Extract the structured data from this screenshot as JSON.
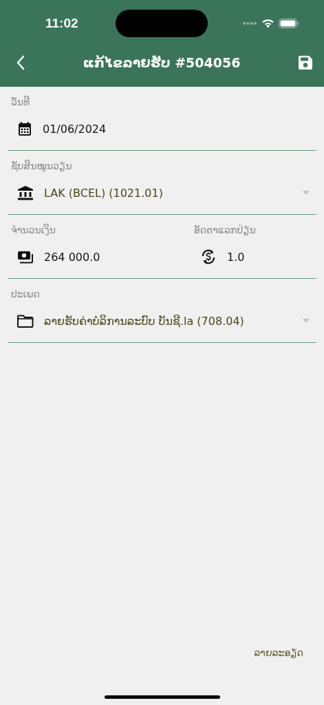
{
  "status_bar": {
    "time": "11:02"
  },
  "header": {
    "title": "ແກ້ໄຂລາຍຮັບ #504056"
  },
  "form_rows": [
    {
      "fields": [
        {
          "kind": "date",
          "label": "ວັນທີ",
          "value": "01/06/2024"
        }
      ]
    },
    {
      "fields": [
        {
          "kind": "account",
          "label": "ຊັບສິນໝູນວຽນ",
          "value": "LAK (BCEL) (1021.01)"
        }
      ]
    },
    {
      "fields": [
        {
          "kind": "amount",
          "label": "ຈຳນວນເງິນ",
          "value": "264 000.0"
        },
        {
          "kind": "rate",
          "label": "ອັດຕາແລກປ່ຽນ",
          "value": "1.0"
        }
      ]
    },
    {
      "fields": [
        {
          "kind": "category",
          "label": "ປະເພດ",
          "value": "ລາຍຮັບຄ່າບໍລິການລະບົບ ບັນຊີ.la (708.04)"
        }
      ]
    }
  ],
  "details_link": "ລາຍລະອຽດ"
}
